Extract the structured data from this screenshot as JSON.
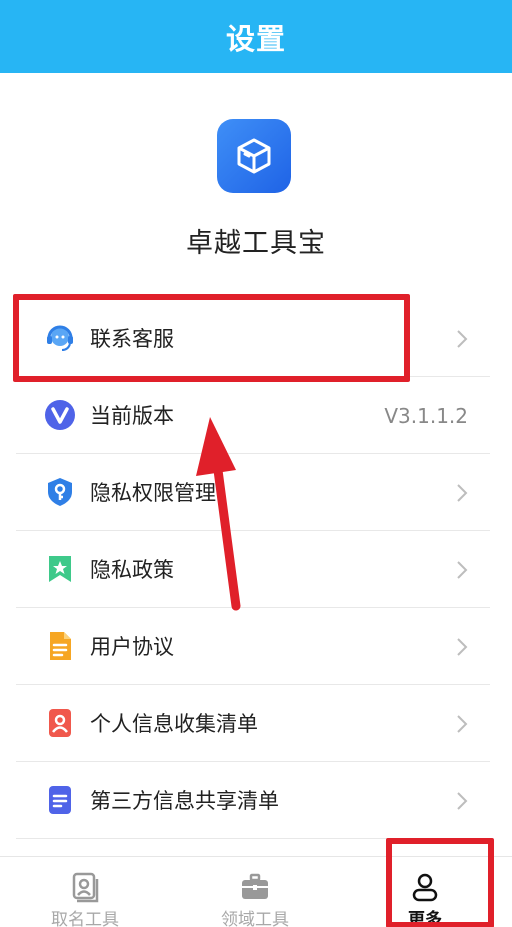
{
  "header": {
    "title": "设置"
  },
  "app": {
    "name": "卓越工具宝",
    "icon": "box-app-icon"
  },
  "menu": [
    {
      "label": "联系客服",
      "icon": "customer-service-icon",
      "right": ""
    },
    {
      "label": "当前版本",
      "icon": "version-icon",
      "right": "V3.1.1.2"
    },
    {
      "label": "隐私权限管理",
      "icon": "shield-key-icon",
      "right": ""
    },
    {
      "label": "隐私政策",
      "icon": "bookmark-star-icon",
      "right": ""
    },
    {
      "label": "用户协议",
      "icon": "document-icon",
      "right": ""
    },
    {
      "label": "个人信息收集清单",
      "icon": "person-card-icon",
      "right": ""
    },
    {
      "label": "第三方信息共享清单",
      "icon": "list-doc-icon",
      "right": ""
    }
  ],
  "tabbar": [
    {
      "label": "取名工具",
      "icon": "name-tool-icon",
      "active": false
    },
    {
      "label": "领域工具",
      "icon": "briefcase-icon",
      "active": false
    },
    {
      "label": "更多",
      "icon": "user-icon",
      "active": true
    }
  ],
  "colors": {
    "header": "#27b5f4",
    "annotation": "#e0202a"
  }
}
